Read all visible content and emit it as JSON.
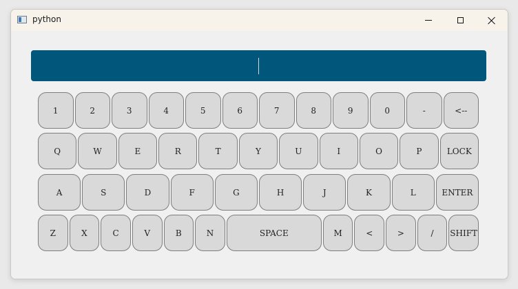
{
  "window": {
    "title": "python",
    "icon": "python-app-icon",
    "controls": [
      "minimize-icon",
      "maximize-icon",
      "close-icon"
    ]
  },
  "display": {
    "value": "",
    "background": "#01577b",
    "text_color": "#ffffff"
  },
  "keyboard": {
    "key_color": "#d9d9d9",
    "rows": [
      [
        "1",
        "2",
        "3",
        "4",
        "5",
        "6",
        "7",
        "8",
        "9",
        "0",
        "-",
        "<--"
      ],
      [
        "Q",
        "W",
        "E",
        "R",
        "T",
        "Y",
        "U",
        "I",
        "O",
        "P",
        "LOCK"
      ],
      [
        "A",
        "S",
        "D",
        "F",
        "G",
        "H",
        "J",
        "K",
        "L",
        "ENTER"
      ],
      [
        "Z",
        "X",
        "C",
        "V",
        "B",
        "N",
        "SPACE",
        "M",
        "<",
        ">",
        "/",
        "SHIFT"
      ]
    ]
  }
}
